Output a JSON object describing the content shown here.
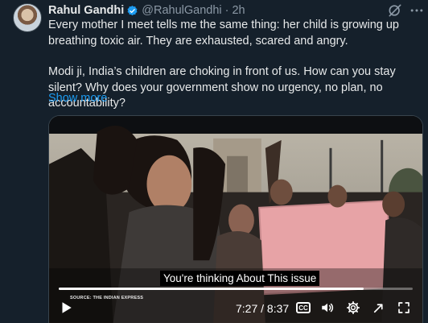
{
  "tweet": {
    "name": "Rahul Gandhi",
    "handle_time": "@RahulGandhi · 2h",
    "paragraphs": [
      "Every mother I meet tells me the same thing: her child is growing up breathing toxic air. They are exhausted, scared and angry.",
      "Modi ji, India’s children are choking in front of us. How can you stay silent? Why does your government show no urgency, no plan, no accountability?"
    ],
    "show_more": "Show more"
  },
  "video": {
    "caption": "You're thinking About This issue",
    "source": "SOURCE: THE INDIAN EXPRESS",
    "time": "7:27 / 8:37",
    "cc_label": "CC",
    "progress_fraction": 0.862
  },
  "colors": {
    "background": "#15202b",
    "text": "#e7e9ea",
    "secondary": "#8b98a5",
    "link": "#1d9bf0",
    "verified": "#1d9bf0"
  }
}
